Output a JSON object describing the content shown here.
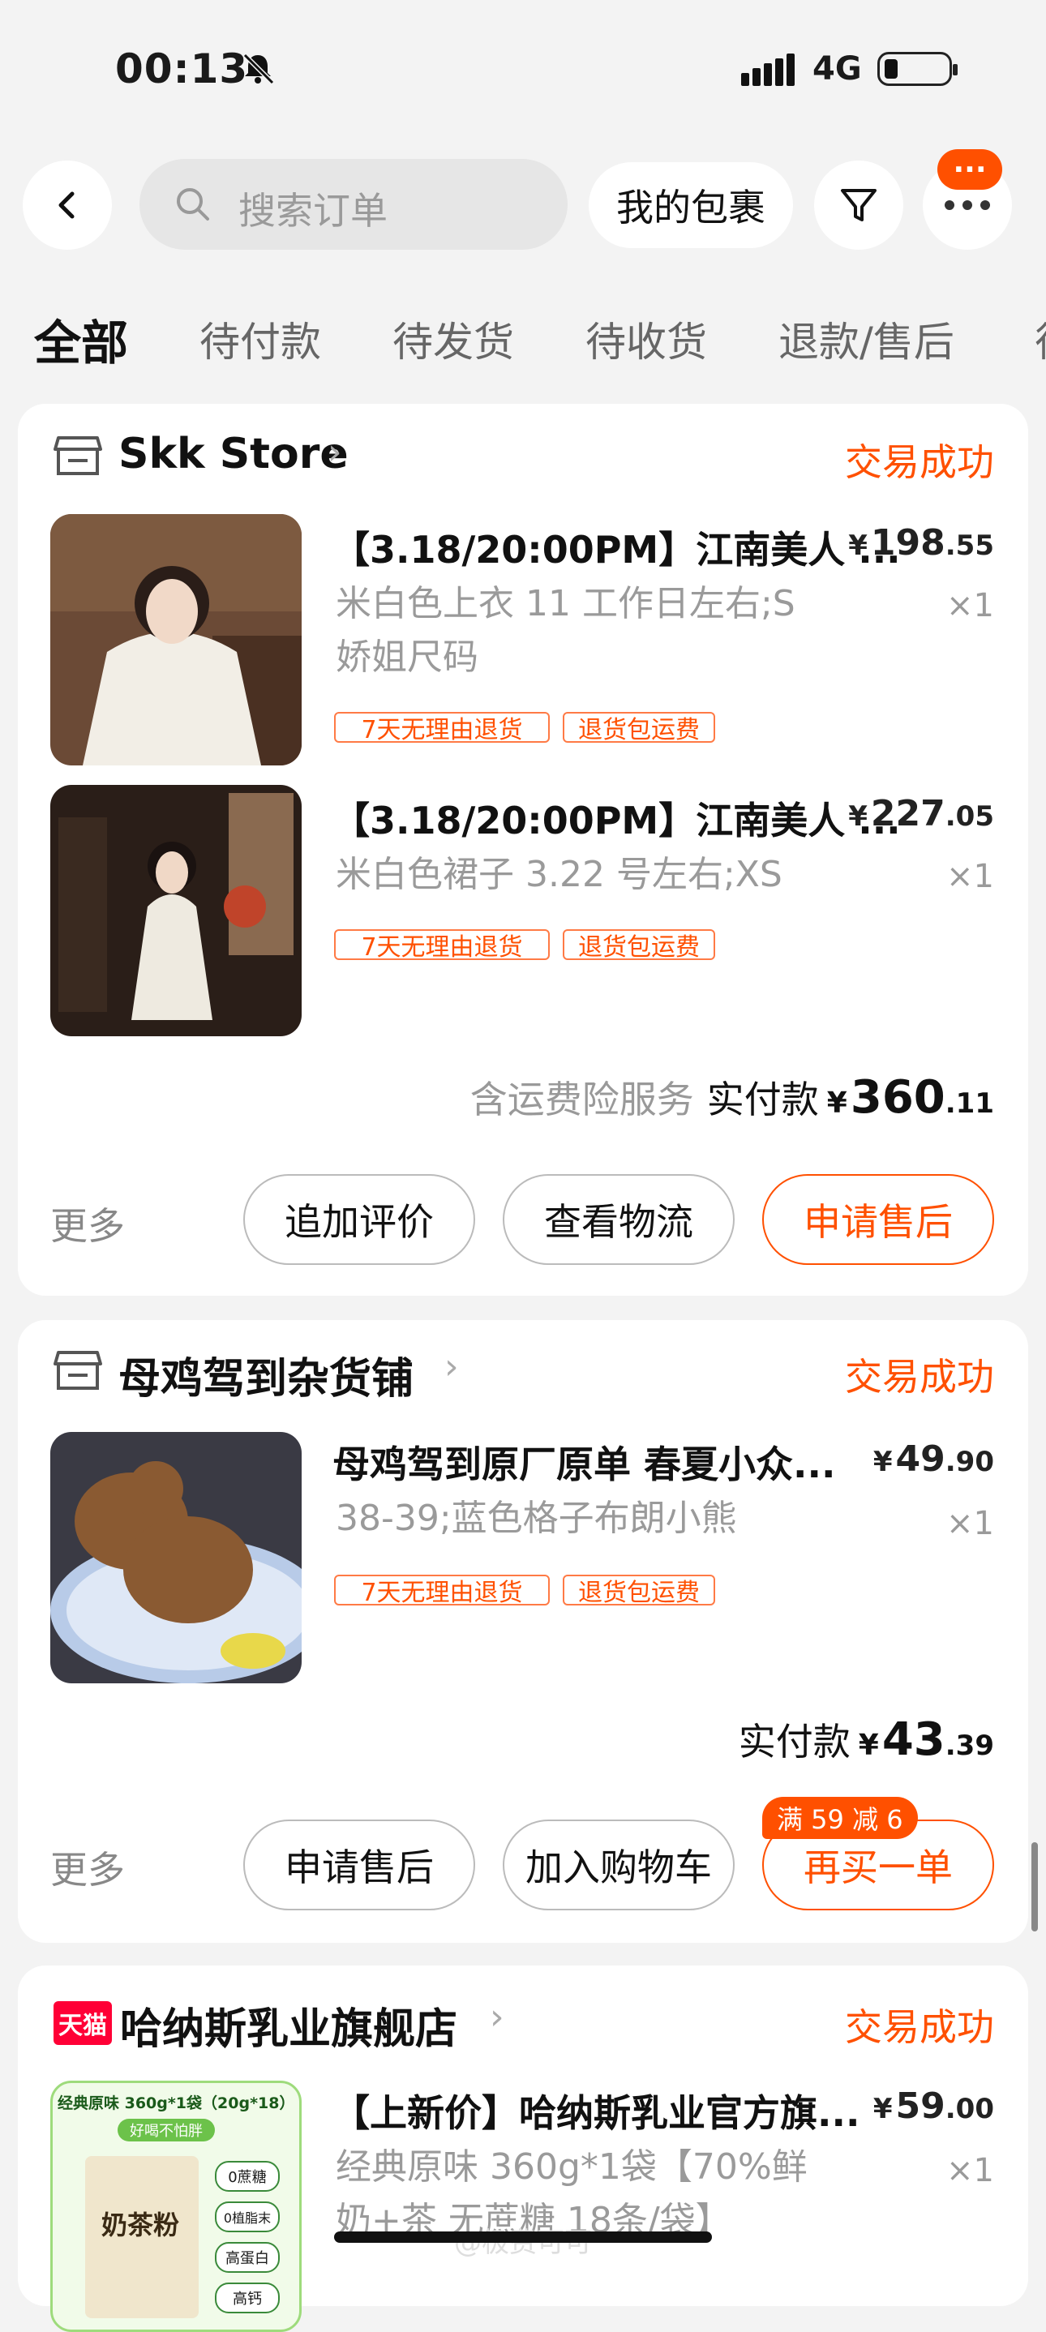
{
  "status_bar": {
    "time": "00:13",
    "network": "4G"
  },
  "nav": {
    "search_placeholder": "搜索订单",
    "packages_label": "我的包裹",
    "message_badge": "···"
  },
  "tabs": [
    {
      "label": "全部",
      "active": true
    },
    {
      "label": "待付款"
    },
    {
      "label": "待发货"
    },
    {
      "label": "待收货"
    },
    {
      "label": "退款/售后"
    },
    {
      "label": "待"
    }
  ],
  "orders": [
    {
      "shop": "Skk Store",
      "status": "交易成功",
      "items": [
        {
          "title": "【3.18/20:00PM】江南美人 ...",
          "sku_line1": "米白色上衣 11 工作日左右;S",
          "sku_line2": "娇姐尺码",
          "price_int": "198",
          "price_dec": ".55",
          "qty": "×1",
          "tags": [
            "7天无理由退货",
            "退货包运费"
          ]
        },
        {
          "title": "【3.18/20:00PM】江南美人 ...",
          "sku_line1": "米白色裙子 3.22 号左右;XS",
          "price_int": "227",
          "price_dec": ".05",
          "qty": "×1",
          "tags": [
            "7天无理由退货",
            "退货包运费"
          ]
        }
      ],
      "total": {
        "note": "含运费险服务",
        "label": "实付款",
        "int": "360",
        "dec": ".11"
      },
      "more": "更多",
      "buttons": [
        "追加评价",
        "查看物流",
        "申请售后"
      ]
    },
    {
      "shop": "母鸡驾到杂货铺",
      "status": "交易成功",
      "items": [
        {
          "title": "母鸡驾到原厂原单 春夏小众...",
          "sku_line1": "38-39;蓝色格子布朗小熊",
          "price_int": "49",
          "price_dec": ".90",
          "qty": "×1",
          "tags": [
            "7天无理由退货",
            "退货包运费"
          ]
        }
      ],
      "total": {
        "label": "实付款",
        "int": "43",
        "dec": ".39"
      },
      "more": "更多",
      "promo": "满 59 减 6",
      "buttons": [
        "申请售后",
        "加入购物车",
        "再买一单"
      ]
    },
    {
      "shop": "哈纳斯乳业旗舰店",
      "shop_badge": "天猫",
      "status": "交易成功",
      "items": [
        {
          "title": "【上新价】哈纳斯乳业官方旗...",
          "sku_line1": "经典原味 360g*1袋【70%鲜",
          "sku_line2": "奶+茶 无蔗糖 18条/袋】",
          "price_int": "59",
          "price_dec": ".00",
          "qty": "×1",
          "thumb_text": {
            "top": "经典原味 360g*1袋（20g*18）",
            "banner": "好喝不怕胖",
            "name": "奶茶粉",
            "badges": [
              "0蔗糖",
              "0植脂末",
              "高蛋白",
              "高钙"
            ]
          }
        }
      ]
    }
  ],
  "currency": "¥",
  "watermark": "@极费可可"
}
